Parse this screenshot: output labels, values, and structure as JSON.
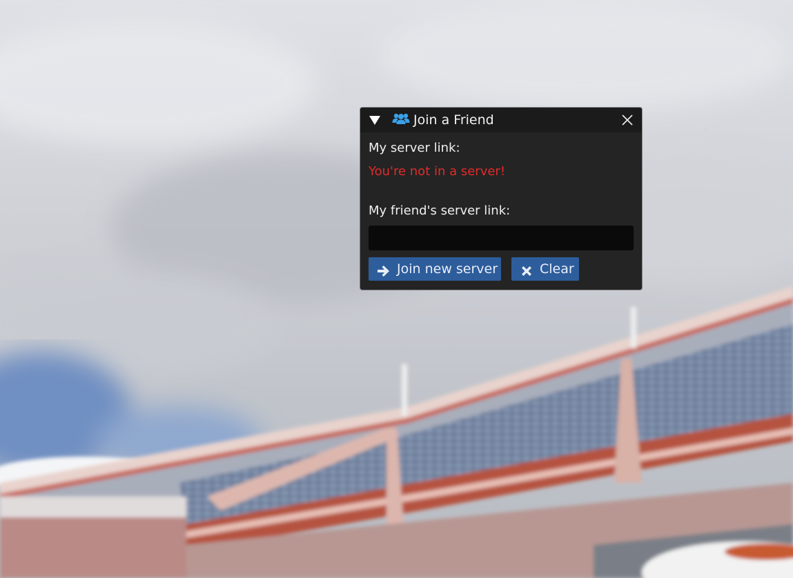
{
  "window": {
    "title": "Join a Friend",
    "icons": {
      "collapse": "triangle-down-icon",
      "title": "users-icon",
      "close": "close-icon"
    }
  },
  "my_server": {
    "label": "My server link:",
    "status": "You're not in a server!"
  },
  "friend_server": {
    "label": "My friend's server link:",
    "input_value": ""
  },
  "buttons": {
    "join_label": "Join new server",
    "join_icon": "arrow-right-icon",
    "clear_label": "Clear",
    "clear_icon": "x-icon"
  },
  "colors": {
    "window_bg": "#242424",
    "titlebar_bg": "#1b1b1b",
    "button_bg": "#2e5d9c",
    "status_error": "#e02b2b",
    "title_icon": "#3aa0e8"
  }
}
